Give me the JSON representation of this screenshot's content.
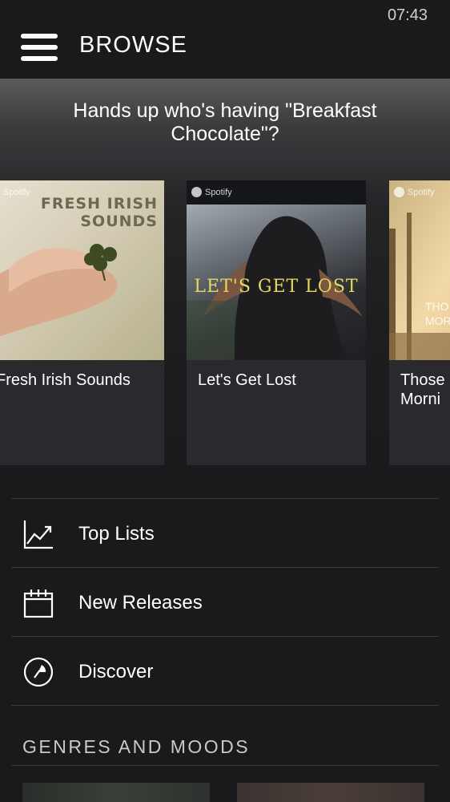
{
  "status_bar": {
    "time": "07:43"
  },
  "header": {
    "title": "BROWSE",
    "menu_icon": "hamburger-menu-icon"
  },
  "featured": {
    "tagline": "Hands up who's having \"Breakfast Chocolate\"?",
    "playlists": [
      {
        "label": "Fresh Irish Sounds",
        "art_brand": "Spotify",
        "art_text": "FRESH IRISH SOUNDS",
        "accent": "#6b6a4e"
      },
      {
        "label": "Let's Get Lost",
        "art_brand": "Spotify",
        "art_text": "LET'S GET LOST",
        "accent": "#e4d860"
      },
      {
        "label": "Those Morni",
        "art_brand": "Spotify",
        "art_text": "THO MOR",
        "accent": "#f2d9a8"
      }
    ]
  },
  "menu": [
    {
      "label": "Top Lists",
      "icon": "chart-line-icon"
    },
    {
      "label": "New Releases",
      "icon": "calendar-icon"
    },
    {
      "label": "Discover",
      "icon": "compass-icon"
    }
  ],
  "genres": {
    "title": "GENRES AND MOODS"
  },
  "colors": {
    "background": "#1a1a1c",
    "card": "#2a2a2e",
    "divider": "#3a3a3d",
    "text": "#ffffff"
  }
}
